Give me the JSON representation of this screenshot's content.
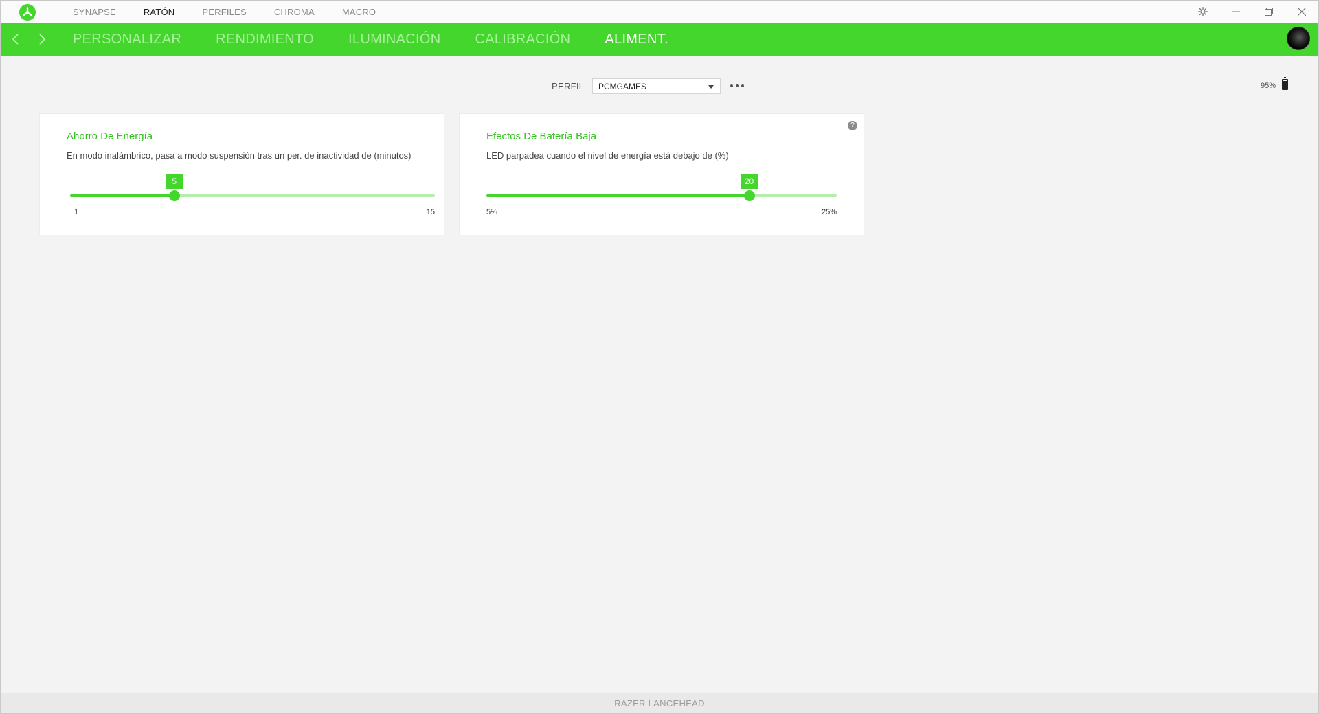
{
  "titlebar": {
    "tabs": [
      "SYNAPSE",
      "RATÓN",
      "PERFILES",
      "CHROMA",
      "MACRO"
    ],
    "active_tab": "RATÓN",
    "icons": [
      "razer-logo-icon",
      "gear-icon",
      "minimize-icon",
      "restore-icon",
      "close-icon"
    ]
  },
  "subnav": {
    "tabs": [
      "PERSONALIZAR",
      "RENDIMIENTO",
      "ILUMINACIÓN",
      "CALIBRACIÓN",
      "ALIMENT."
    ],
    "active_tab": "ALIMENT.",
    "accent_color": "#44d62c"
  },
  "profile": {
    "label": "PERFIL",
    "selected": "PCMGAMES"
  },
  "battery": {
    "level_text": "95%"
  },
  "cards": {
    "power_saving": {
      "title": "Ahorro De Energía",
      "description": "En modo inalámbrico, pasa a modo suspensión tras un per. de inactividad de (minutos)",
      "value": "5",
      "min_label": "1",
      "max_label": "15",
      "min": 1,
      "max": 15,
      "current": 5
    },
    "low_battery": {
      "title": "Efectos De Batería Baja",
      "description": "LED parpadea cuando el nivel de energía está debajo de (%)",
      "value": "20",
      "min_label": "5%",
      "max_label": "25%",
      "min": 5,
      "max": 25,
      "current": 20,
      "help": "?"
    }
  },
  "statusbar": {
    "device": "RAZER LANCEHEAD"
  }
}
